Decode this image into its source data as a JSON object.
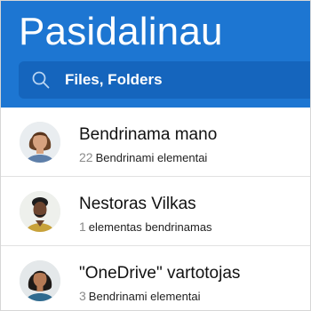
{
  "header": {
    "title": "Pasidalinau",
    "background_color": "#1d76d2"
  },
  "search": {
    "placeholder": "Files, Folders",
    "icon": "search-icon"
  },
  "shares": [
    {
      "name": "Bendrinama mano",
      "count": "22",
      "description": "Bendrinami elementai",
      "avatar": "woman-avatar"
    },
    {
      "name": "Nestoras Vilkas",
      "count": "1",
      "description": "elementas bendrinamas",
      "avatar": "man-avatar"
    },
    {
      "name": "\"OneDrive\" vartotojas",
      "count": "3",
      "description": "Bendrinami elementai",
      "avatar": "woman-avatar"
    }
  ]
}
